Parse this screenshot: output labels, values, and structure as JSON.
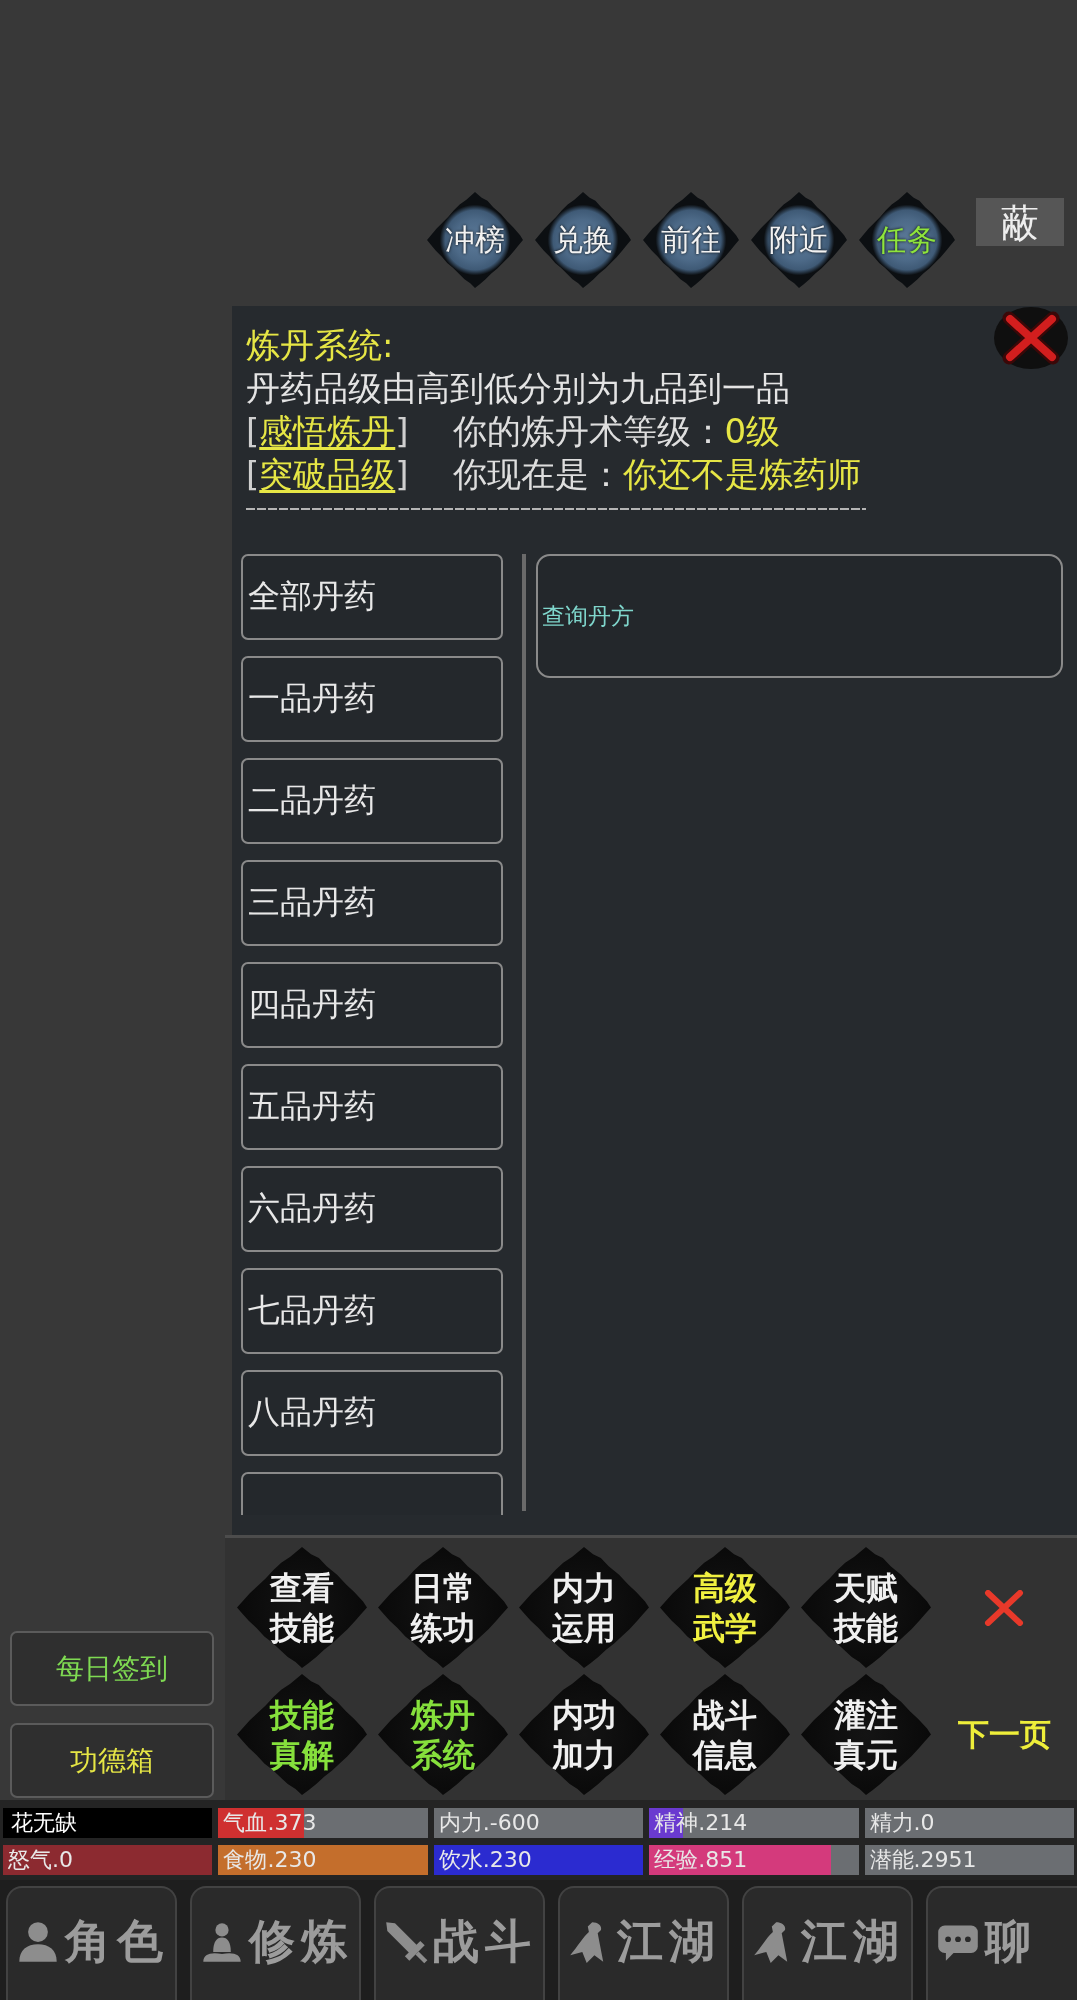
{
  "top_buttons": [
    {
      "label": "冲榜",
      "color": "#f2f2f2"
    },
    {
      "label": "兑换",
      "color": "#f2f2f2"
    },
    {
      "label": "前往",
      "color": "#f2f2f2"
    },
    {
      "label": "附近",
      "color": "#f2f2f2"
    },
    {
      "label": "任务",
      "color": "#8ee43c"
    }
  ],
  "hide_button": {
    "label": "蔽"
  },
  "alchemy_panel": {
    "title": "炼丹系统:",
    "description": "丹药品级由高到低分别为九品到一品",
    "actions": [
      {
        "link": "[感悟炼丹]",
        "label": "你的炼丹术等级：",
        "value": "0级"
      },
      {
        "link": "[突破品级]",
        "label": "你现在是：",
        "value": "你还不是炼药师"
      }
    ],
    "categories": [
      {
        "label": "全部丹药"
      },
      {
        "label": "一品丹药"
      },
      {
        "label": "二品丹药"
      },
      {
        "label": "三品丹药"
      },
      {
        "label": "四品丹药"
      },
      {
        "label": "五品丹药"
      },
      {
        "label": "六品丹药"
      },
      {
        "label": "七品丹药"
      },
      {
        "label": "八品丹药"
      }
    ],
    "more_categories_below": true,
    "recipe_query": {
      "label": "查询丹方"
    }
  },
  "side_buttons": [
    {
      "label": "每日签到",
      "color": "#7fda52"
    },
    {
      "label": "功德箱",
      "color": "#e5e545"
    }
  ],
  "skill_menu": {
    "buttons": [
      {
        "label": "查看技能",
        "color": "#f0f0f0"
      },
      {
        "label": "日常练功",
        "color": "#f0f0f0"
      },
      {
        "label": "内力运用",
        "color": "#f0f0f0"
      },
      {
        "label": "高级武学",
        "color": "#f0f040"
      },
      {
        "label": "天赋技能",
        "color": "#f0f0f0"
      },
      {
        "label": "技能真解",
        "color": "#86e03c"
      },
      {
        "label": "炼丹系统",
        "color": "#86e03c"
      },
      {
        "label": "内功加力",
        "color": "#f0f0f0"
      },
      {
        "label": "战斗信息",
        "color": "#f0f0f0"
      },
      {
        "label": "灌注真元",
        "color": "#f0f0f0"
      }
    ],
    "next_page": "下一页"
  },
  "stats": [
    [
      {
        "kind": "name",
        "label": "花无缺"
      },
      {
        "kind": "bar",
        "label": "气血.373",
        "level": 0.41,
        "color": "#cf3030"
      },
      {
        "kind": "bar",
        "label": "内力.-600"
      },
      {
        "kind": "bar",
        "label": "精神.214",
        "level": 0.16,
        "color": "#6a3ad0"
      },
      {
        "kind": "bar",
        "label": "精力.0"
      }
    ],
    [
      {
        "kind": "bar",
        "label": "怒气.0",
        "level": 1,
        "color": "#8c2a30"
      },
      {
        "kind": "bar",
        "label": "食物.230",
        "level": 1,
        "color": "#c46e2c"
      },
      {
        "kind": "bar",
        "label": "饮水.230",
        "level": 1,
        "color": "#2b2bd0"
      },
      {
        "kind": "bar",
        "label": "经验.851",
        "level": 0.87,
        "color": "#d43a7c"
      },
      {
        "kind": "bar",
        "label": "潜能.2951"
      }
    ]
  ],
  "nav_tabs": [
    {
      "kind": "character",
      "label": "角色"
    },
    {
      "kind": "training",
      "label": "修炼"
    },
    {
      "kind": "battle",
      "label": "战斗"
    },
    {
      "kind": "world",
      "label": "江湖"
    },
    {
      "kind": "world",
      "label": "江湖"
    },
    {
      "kind": "chat",
      "label": "聊"
    }
  ]
}
